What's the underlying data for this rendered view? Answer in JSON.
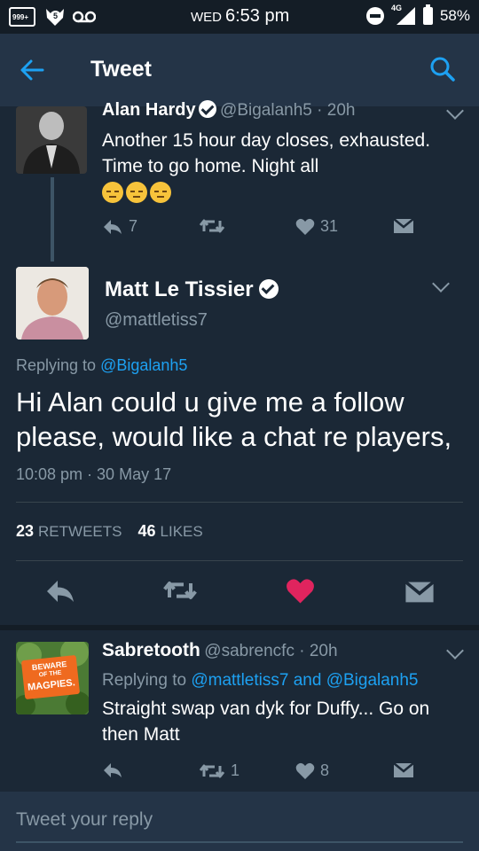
{
  "status_bar": {
    "notif_badge": "999+",
    "app_badge": "5",
    "day": "WED",
    "time": "6:53 pm",
    "network": "4G",
    "battery": "58%"
  },
  "topbar": {
    "title": "Tweet"
  },
  "prev_tweet": {
    "name": "Alan Hardy",
    "handle": "@Bigalanh5",
    "age": "20h",
    "text": "Another 15 hour day closes, exhausted. Time to go home. Night all",
    "emoji_count": 3,
    "reply_count": "7",
    "like_count": "31"
  },
  "main_tweet": {
    "name": "Matt Le Tissier",
    "handle": "@mattletiss7",
    "replying_prefix": "Replying to",
    "replying_to": "@Bigalanh5",
    "text": "Hi Alan could u give me a follow please, would like a chat re players,",
    "timestamp": "10:08 pm · 30 May 17",
    "retweets": "23",
    "retweets_label": "RETWEETS",
    "likes": "46",
    "likes_label": "LIKES"
  },
  "reply_tweet": {
    "name": "Sabretooth",
    "handle": "@sabrencfc",
    "age": "20h",
    "replying_prefix": "Replying to",
    "replying_to": "@mattletiss7 and @Bigalanh5",
    "text": "Straight swap van dyk for Duffy... Go on then Matt",
    "retweet_count": "1",
    "like_count": "8",
    "avatar_sign": [
      "BEWARE",
      "OF THE",
      "MAGPIES."
    ]
  },
  "compose": {
    "placeholder": "Tweet your reply"
  },
  "colors": {
    "background": "#1b2836",
    "bar": "#243447",
    "accent": "#1da1f2",
    "like": "#e0245e",
    "muted": "#8899a6"
  }
}
